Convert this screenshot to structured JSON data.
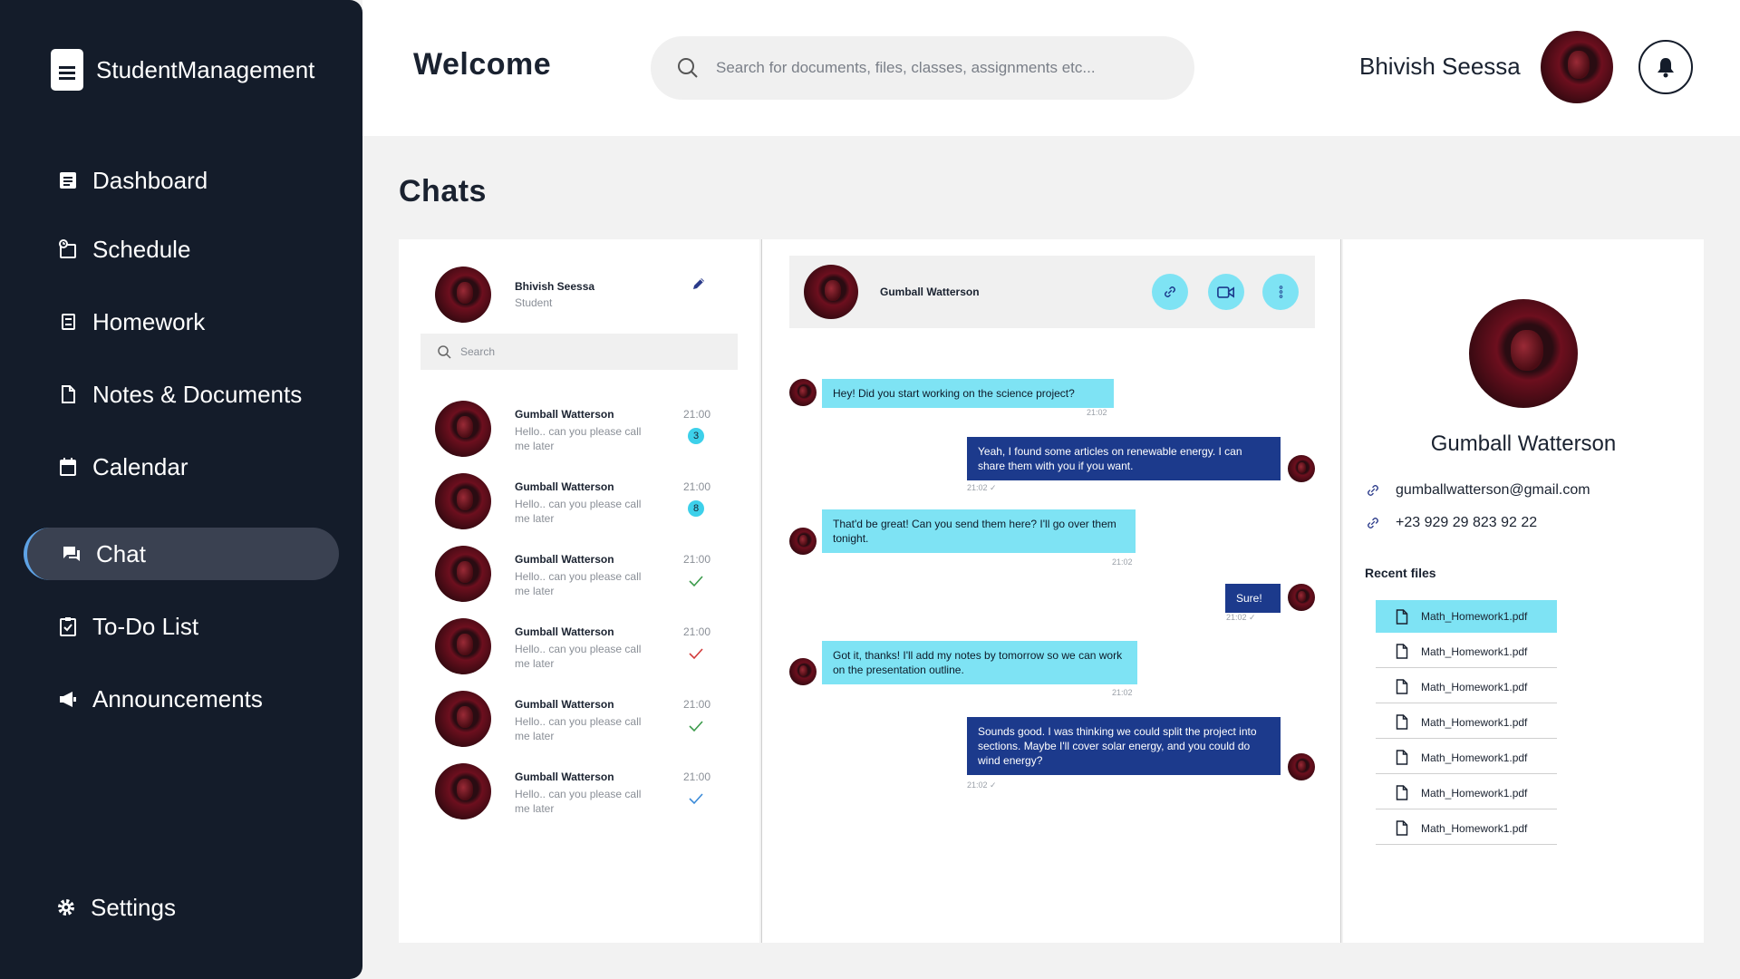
{
  "brand": {
    "name": "StudentManagement"
  },
  "nav": [
    {
      "label": "Dashboard",
      "icon": "dashboard-icon"
    },
    {
      "label": "Schedule",
      "icon": "schedule-icon"
    },
    {
      "label": "Homework",
      "icon": "homework-icon"
    },
    {
      "label": "Notes & Documents",
      "icon": "document-icon"
    },
    {
      "label": "Calendar",
      "icon": "calendar-icon"
    },
    {
      "label": "Chat",
      "icon": "chat-icon",
      "active": true
    },
    {
      "label": "To-Do List",
      "icon": "todo-icon"
    },
    {
      "label": "Announcements",
      "icon": "megaphone-icon"
    }
  ],
  "settings_label": "Settings",
  "header": {
    "welcome": "Welcome",
    "search_placeholder": "Search for documents, files, classes, assignments etc...",
    "user_name": "Bhivish Seessa"
  },
  "page_title": "Chats",
  "me": {
    "name": "Bhivish Seessa",
    "role": "Student"
  },
  "list_search_placeholder": "Search",
  "conversations": [
    {
      "name": "Gumball Watterson",
      "message": "Hello.. can you please call me later",
      "time": "21:00",
      "badge": "3",
      "status": "unread"
    },
    {
      "name": "Gumball Watterson",
      "message": "Hello.. can you please call me later",
      "time": "21:00",
      "badge": "8",
      "status": "unread"
    },
    {
      "name": "Gumball Watterson",
      "message": "Hello.. can you please call me later",
      "time": "21:00",
      "status": "read",
      "tick_color": "#3a9a4a"
    },
    {
      "name": "Gumball Watterson",
      "message": "Hello.. can you please call me later",
      "time": "21:00",
      "status": "read",
      "tick_color": "#d23a3a"
    },
    {
      "name": "Gumball Watterson",
      "message": "Hello.. can you please call me later",
      "time": "21:00",
      "status": "read",
      "tick_color": "#3a9a4a"
    },
    {
      "name": "Gumball Watterson",
      "message": "Hello.. can you please call me later",
      "time": "21:00",
      "status": "read",
      "tick_color": "#3a8ad8"
    }
  ],
  "chat": {
    "contact_name": "Gumball Watterson",
    "messages": [
      {
        "dir": "in",
        "text": "Hey! Did you start working on the science project?",
        "time": "21:02"
      },
      {
        "dir": "out",
        "text": "Yeah, I found some articles on renewable energy. I can share them with you if you want.",
        "time": "21:02 ✓"
      },
      {
        "dir": "in",
        "text": "That'd be great! Can you send them here? I'll go over them tonight.",
        "time": "21:02"
      },
      {
        "dir": "out",
        "text": "Sure!",
        "time": "21:02 ✓"
      },
      {
        "dir": "in",
        "text": "Got it, thanks! I'll add my notes by tomorrow so we can work on the presentation outline.",
        "time": "21:02"
      },
      {
        "dir": "out",
        "text": "Sounds good. I was thinking we could split the project into sections. Maybe I'll cover solar energy, and you could do wind energy?",
        "time": "21:02 ✓"
      }
    ]
  },
  "contact": {
    "name": "Gumball Watterson",
    "email": "gumballwatterson@gmail.com",
    "phone": "+23 929 29 823 92 22",
    "recent_files_title": "Recent files",
    "files": [
      "Math_Homework1.pdf",
      "Math_Homework1.pdf",
      "Math_Homework1.pdf",
      "Math_Homework1.pdf",
      "Math_Homework1.pdf",
      "Math_Homework1.pdf",
      "Math_Homework1.pdf"
    ]
  },
  "colors": {
    "sidebar": "#141c2a",
    "accent": "#7ee3f4",
    "outgoing": "#1c3a8c",
    "active_nav": "#3a4151"
  }
}
